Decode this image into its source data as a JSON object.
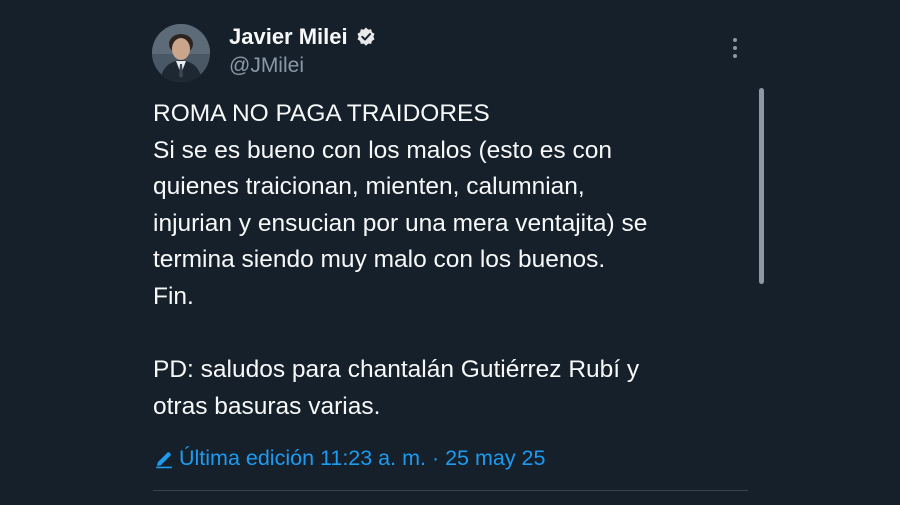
{
  "author": {
    "display_name": "Javier Milei",
    "handle": "@JMilei",
    "verified": true,
    "avatar": "profile-photo"
  },
  "tweet": {
    "lines": [
      "ROMA NO PAGA TRAIDORES",
      "Si se es bueno con los malos (esto es con",
      "quienes traicionan, mienten, calumnian,",
      "injurian y ensucian por una mera ventajita) se",
      "termina siendo muy malo con los buenos.",
      "Fin.",
      "",
      "PD: saludos para chantalán Gutiérrez Rubí y",
      "otras basuras varias."
    ],
    "edited_label": "Última edición 11:23 a. m. · 25 may 25"
  },
  "colors": {
    "background": "#15202b",
    "text": "#f7f9f9",
    "secondary_text": "#8b98a5",
    "accent": "#1d9bf0",
    "divider": "#38444d"
  },
  "icons": {
    "verified": "verified-badge-icon",
    "more": "more-options-icon",
    "edit": "pencil-icon"
  }
}
